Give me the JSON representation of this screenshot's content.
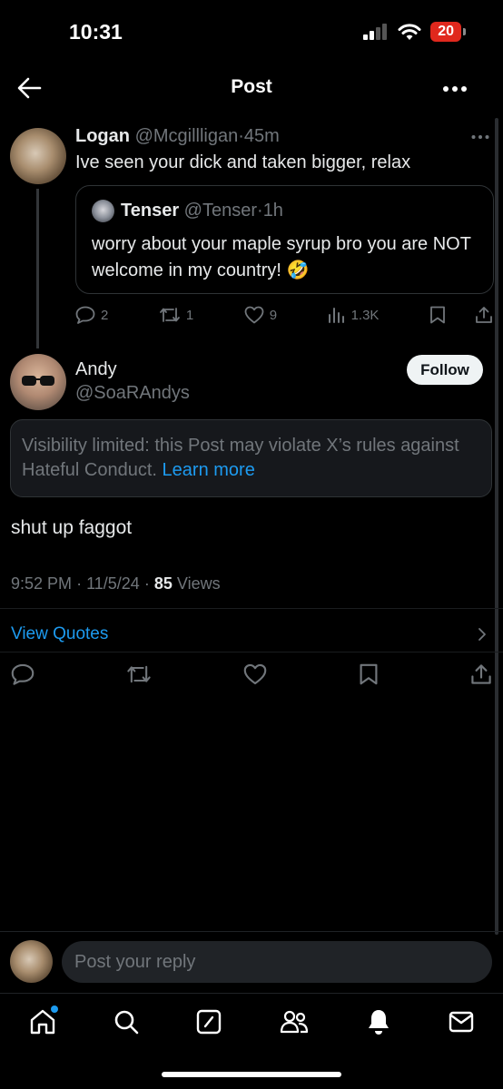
{
  "status_bar": {
    "time": "10:31",
    "battery": "20"
  },
  "header": {
    "title": "Post"
  },
  "parent_post": {
    "name": "Logan",
    "handle": "@Mcgillligan",
    "sep": "·",
    "time": "45m",
    "text": "Ive seen your dick and taken bigger, relax",
    "quote": {
      "name": "Tenser",
      "handle": "@Tenser",
      "sep": "·",
      "time": "1h",
      "text": "worry about your maple syrup bro you are NOT welcome in my country! 🤣"
    },
    "actions": {
      "replies": "2",
      "reposts": "1",
      "likes": "9",
      "views": "1.3K"
    }
  },
  "main_post": {
    "name": "Andy",
    "handle": "@SoaRAndys",
    "follow_label": "Follow",
    "notice_text": "Visibility limited: this Post may violate X’s rules against Hateful Conduct.",
    "notice_link": "Learn more",
    "text": "shut up faggot",
    "time": "9:52 PM",
    "date": "11/5/24",
    "views_count": "85",
    "views_label": "Views",
    "meta_sep": "·",
    "view_quotes": "View Quotes"
  },
  "reply": {
    "placeholder": "Post your reply"
  },
  "colors": {
    "background": "#000000",
    "accent": "#1d9bf0",
    "muted": "#71767b",
    "battery": "#e0281d"
  },
  "icons": {
    "status": [
      "signal-icon",
      "wifi-icon",
      "battery-icon"
    ],
    "tabbar": [
      "home-icon",
      "search-icon",
      "compose-icon",
      "communities-icon",
      "notifications-icon",
      "messages-icon"
    ]
  }
}
